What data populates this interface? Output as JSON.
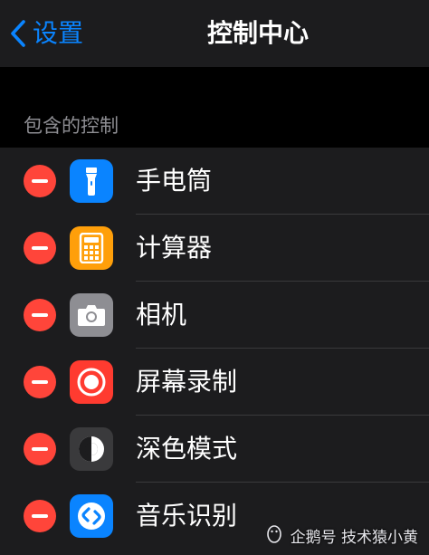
{
  "nav": {
    "back_label": "设置",
    "title": "控制中心"
  },
  "section": {
    "header": "包含的控制"
  },
  "items": [
    {
      "label": "手电筒",
      "icon": "flashlight-icon",
      "color": "#0a84ff"
    },
    {
      "label": "计算器",
      "icon": "calculator-icon",
      "color": "#ff9f0a"
    },
    {
      "label": "相机",
      "icon": "camera-icon",
      "color": "#8e8e93"
    },
    {
      "label": "屏幕录制",
      "icon": "screen-record-icon",
      "color": "#ff3b30"
    },
    {
      "label": "深色模式",
      "icon": "dark-mode-icon",
      "color": "#3a3a3c"
    },
    {
      "label": "音乐识别",
      "icon": "shazam-icon",
      "color": "#0a84ff"
    }
  ],
  "colors": {
    "accent": "#0a84ff",
    "delete": "#ff453a",
    "background": "#000000",
    "cell": "#1c1c1e"
  },
  "watermark": {
    "text": "企鹅号 技术猿小黄"
  }
}
